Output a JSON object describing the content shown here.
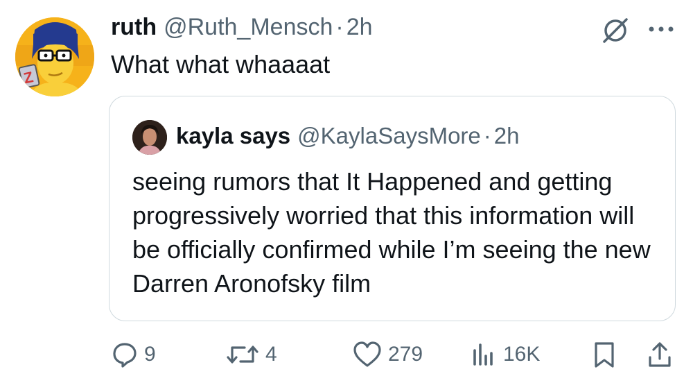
{
  "tweet": {
    "display_name": "ruth",
    "handle": "@Ruth_Mensch",
    "separator": "·",
    "time": "2h",
    "text": "What what whaaaat",
    "avatar_badge": "Z"
  },
  "quoted_tweet": {
    "display_name": "kayla says",
    "handle": "@KaylaSaysMore",
    "separator": "·",
    "time": "2h",
    "text": "seeing rumors that It Happened and getting progressively worried that this information will be officially confirmed while I’m seeing the new Darren Aronofsky film"
  },
  "actions": {
    "replies": "9",
    "reposts": "4",
    "likes": "279",
    "views": "16K"
  },
  "icons": [
    "grok-icon",
    "more-icon",
    "reply-icon",
    "repost-icon",
    "like-icon",
    "views-icon",
    "bookmark-icon",
    "share-icon"
  ],
  "colors": {
    "text": "#0f1419",
    "secondary": "#536471",
    "border": "#cfd9de",
    "avatar_bg": "#f6b21a"
  }
}
